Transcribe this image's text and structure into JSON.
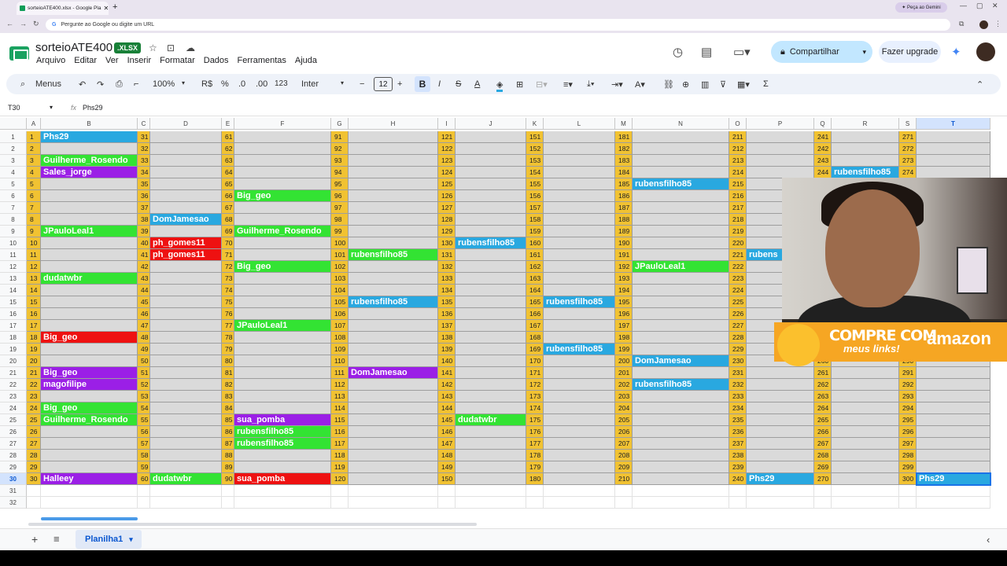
{
  "browser": {
    "tab_title": "sorteioATE400.xlsx - Google Pla",
    "tab_close": "✕",
    "new_tab": "+",
    "omnibox_placeholder": "Pergunte ao Google ou digite um URL",
    "gemini_button": "✦ Peça ao Gemini"
  },
  "doc": {
    "title": "sorteioATE400",
    "badge": ".XLSX"
  },
  "menu": [
    "Arquivo",
    "Editar",
    "Ver",
    "Inserir",
    "Formatar",
    "Dados",
    "Ferramentas",
    "Ajuda"
  ],
  "header": {
    "share": "Compartilhar",
    "upgrade": "Fazer upgrade"
  },
  "toolbar": {
    "menus": "Menus",
    "zoom": "100%",
    "currency": "R$",
    "percent": "%",
    "dec_less": ".0",
    "dec_more": ".00",
    "number_format": "123",
    "font": "Inter",
    "font_size": "12",
    "bold": "B",
    "italic": "I",
    "strike": "S",
    "text_color": "A"
  },
  "formula_bar": {
    "cell_ref": "T30",
    "fx": "fx",
    "value": "Phs29"
  },
  "columns": [
    "A",
    "B",
    "C",
    "D",
    "E",
    "F",
    "G",
    "H",
    "I",
    "J",
    "K",
    "L",
    "M",
    "N",
    "O",
    "P",
    "Q",
    "R",
    "S",
    "T"
  ],
  "selected_column": "T",
  "selected_row": 30,
  "row_count": 32,
  "names": {
    "A": [
      [
        1,
        "Phs29",
        "blue"
      ],
      [
        3,
        "Guilherme_Rosendo",
        "green"
      ],
      [
        4,
        "Sales_jorge",
        "purple"
      ],
      [
        9,
        "JPauloLeal1",
        "green"
      ],
      [
        13,
        "dudatwbr",
        "green"
      ],
      [
        18,
        "Big_geo",
        "red"
      ],
      [
        21,
        "Big_geo",
        "purple"
      ],
      [
        22,
        "magofilipe",
        "purple"
      ],
      [
        24,
        "Big_geo",
        "green"
      ],
      [
        25,
        "Guilherme_Rosendo",
        "green"
      ],
      [
        30,
        "Halleey",
        "purple"
      ]
    ],
    "C": [
      [
        8,
        "DomJamesao",
        "blue"
      ],
      [
        10,
        "ph_gomes11",
        "red"
      ],
      [
        11,
        "ph_gomes11",
        "red"
      ],
      [
        30,
        "dudatwbr",
        "green"
      ]
    ],
    "E": [
      [
        6,
        "Big_geo",
        "green"
      ],
      [
        9,
        "Guilherme_Rosendo",
        "green"
      ],
      [
        12,
        "Big_geo",
        "green"
      ],
      [
        17,
        "JPauloLeal1",
        "green"
      ],
      [
        25,
        "sua_pomba",
        "purple"
      ],
      [
        26,
        "rubensfilho85",
        "green"
      ],
      [
        27,
        "rubensfilho85",
        "green"
      ],
      [
        30,
        "sua_pomba",
        "red"
      ]
    ],
    "G": [
      [
        11,
        "rubensfilho85",
        "green"
      ],
      [
        15,
        "rubensfilho85",
        "blue"
      ],
      [
        21,
        "DomJamesao",
        "purple"
      ]
    ],
    "I": [
      [
        10,
        "rubensfilho85",
        "blue"
      ],
      [
        25,
        "dudatwbr",
        "green"
      ]
    ],
    "K": [
      [
        15,
        "rubensfilho85",
        "blue"
      ],
      [
        19,
        "rubensfilho85",
        "blue"
      ]
    ],
    "M": [
      [
        5,
        "rubensfilho85",
        "blue"
      ],
      [
        12,
        "JPauloLeal1",
        "green"
      ],
      [
        20,
        "DomJamesao",
        "blue"
      ],
      [
        22,
        "rubensfilho85",
        "blue"
      ]
    ],
    "O": [
      [
        11,
        "rubens",
        "blue"
      ],
      [
        30,
        "Phs29",
        "blue"
      ]
    ],
    "Q": [
      [
        4,
        "rubensfilho85",
        "blue"
      ]
    ],
    "S": [
      [
        30,
        "Phs29",
        "blue"
      ]
    ]
  },
  "sheet": {
    "add": "+",
    "all_sheets": "≡",
    "tab": "Planilha1",
    "tab_arrow": "▾",
    "collapse": "‹"
  },
  "overlay": {
    "line1": "COMPRE COM",
    "line2": "meus links!",
    "brand": "amazon"
  }
}
